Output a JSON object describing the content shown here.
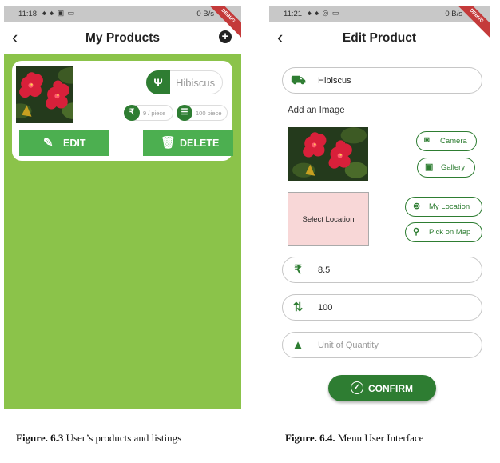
{
  "left_screen": {
    "status": {
      "time": "11:18",
      "net": "0 B/s",
      "debug": "DEBUG"
    },
    "title": "My Products",
    "product": {
      "name": "Hibiscus",
      "price": "9 / piece",
      "quantity": "100 piece",
      "edit_label": "EDIT",
      "delete_label": "DELETE"
    },
    "colors": {
      "background": "#8bc34a",
      "button": "#4caf50",
      "accent": "#2e7d32"
    }
  },
  "right_screen": {
    "status": {
      "time": "11:21",
      "net": "0 B/s",
      "debug": "DEBUG"
    },
    "title": "Edit Product",
    "name_value": "Hibiscus",
    "add_image_label": "Add an Image",
    "camera_label": "Camera",
    "gallery_label": "Gallery",
    "select_location_label": "Select Location",
    "my_location_label": "My Location",
    "pick_on_map_label": "Pick on Map",
    "price_value": "8.5",
    "quantity_value": "100",
    "unit_placeholder": "Unit of Quantity",
    "confirm_label": "CONFIRM",
    "colors": {
      "accent": "#2e7d32",
      "location_box": "#f8d7d7"
    }
  },
  "captions": {
    "left_prefix": "Figure. 6.3",
    "left_text": " User’s products and listings",
    "right_prefix": "Figure. 6.4.",
    "right_text": " Menu User Interface"
  },
  "icons": [
    "chevron-left-icon",
    "add-circle-icon",
    "restaurant-icon",
    "rupee-icon",
    "list-icon",
    "edit-icon",
    "trash-icon",
    "bed-icon",
    "camera-icon",
    "gallery-icon",
    "my-location-icon",
    "map-pin-icon",
    "sort-icon",
    "weight-icon",
    "check-circle-icon"
  ]
}
